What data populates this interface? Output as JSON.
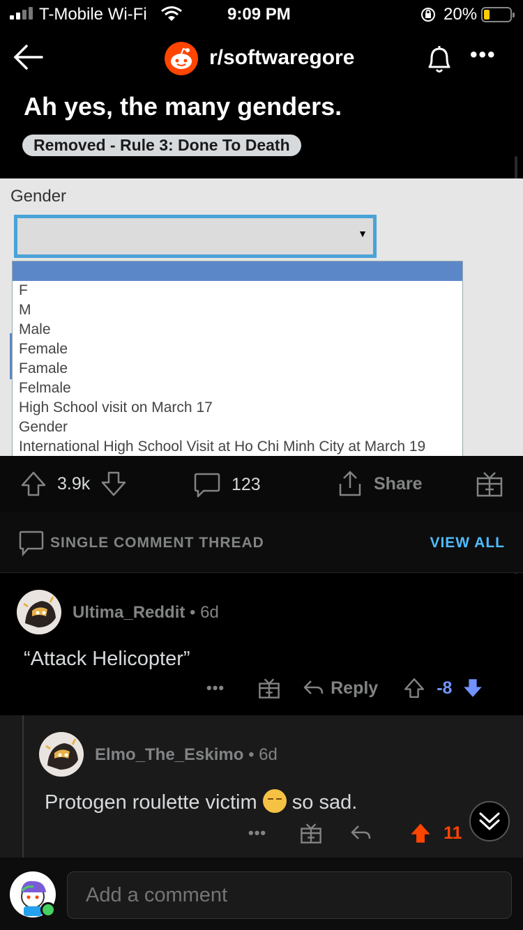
{
  "status_bar": {
    "carrier": "T-Mobile Wi-Fi",
    "time": "9:09 PM",
    "battery": "20%"
  },
  "header": {
    "subreddit": "r/softwaregore"
  },
  "post": {
    "title": "Ah yes, the many genders.",
    "removed_badge": "Removed - Rule 3: Done To Death",
    "image": {
      "field_label": "Gender",
      "options": [
        "F",
        "M",
        "Male",
        "Female",
        "Famale",
        "Felmale",
        "High School visit on March 17",
        "Gender",
        "International High School Visit at Ho Chi Minh City at March 19"
      ]
    },
    "actions": {
      "votes": "3.9k",
      "comments": "123",
      "share": "Share"
    }
  },
  "thread_bar": {
    "label": "SINGLE COMMENT THREAD",
    "view_all": "VIEW ALL"
  },
  "comments": [
    {
      "user": "Ultima_Reddit",
      "age": "6d",
      "text": "“Attack Helicopter”",
      "reply": "Reply",
      "score": "-8"
    },
    {
      "user": "Elmo_The_Eskimo",
      "age": "6d",
      "text_before": "Protogen roulette victim",
      "text_after": "so sad.",
      "score": "11"
    }
  ],
  "composer": {
    "placeholder": "Add a comment"
  },
  "colors": {
    "upvote": "#ff4500",
    "downvote": "#7193ff",
    "link": "#4fbcff"
  }
}
